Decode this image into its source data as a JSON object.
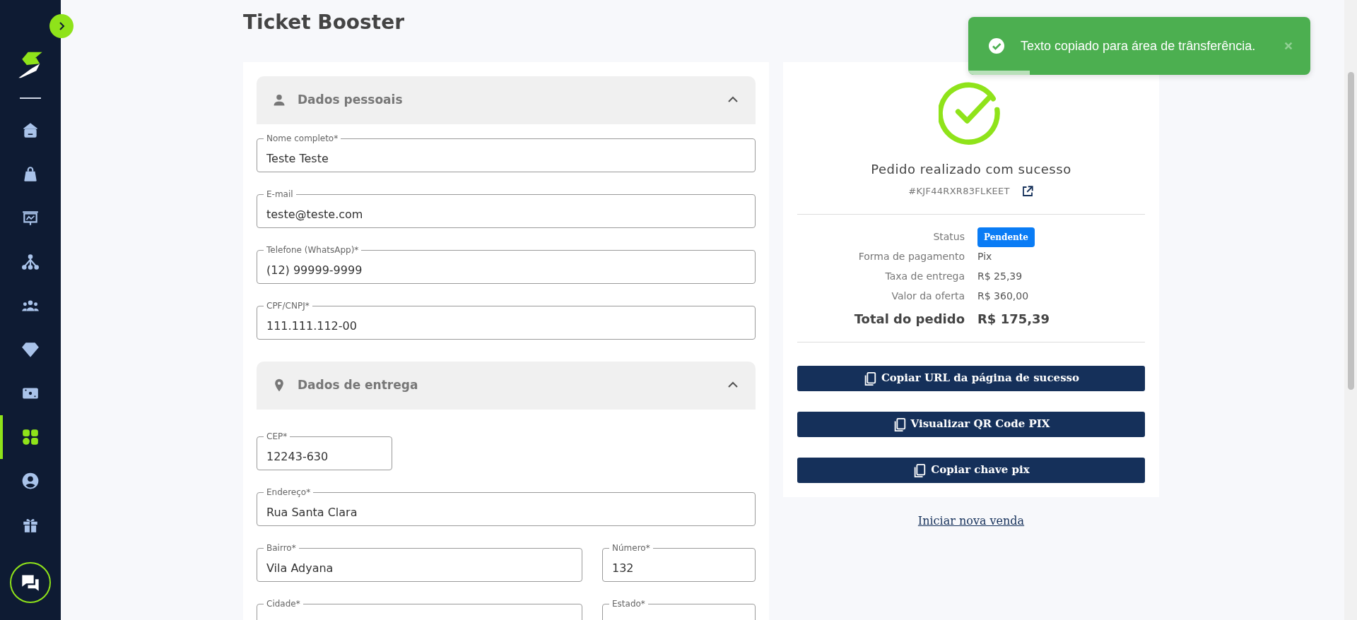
{
  "sidebar": {
    "items": [
      {
        "kind": "home",
        "selected": false
      },
      {
        "kind": "bag",
        "selected": false
      },
      {
        "kind": "presentation",
        "selected": false
      },
      {
        "kind": "network",
        "selected": false
      },
      {
        "kind": "people",
        "selected": false
      },
      {
        "kind": "diamond",
        "selected": false
      },
      {
        "kind": "ticket",
        "selected": false
      },
      {
        "kind": "grid",
        "selected": true
      },
      {
        "kind": "user",
        "selected": false
      },
      {
        "kind": "gift",
        "selected": false
      }
    ]
  },
  "page": {
    "title": "Ticket Booster"
  },
  "form": {
    "sections": [
      {
        "title": "Dados pessoais",
        "kind": "person",
        "expanded": true,
        "rows": [
          [
            {
              "label": "Nome completo*",
              "value": "Teste Teste"
            }
          ],
          [
            {
              "label": "E-mail",
              "value": "teste@teste.com"
            }
          ],
          [
            {
              "label": "Telefone (WhatsApp)*",
              "value": "(12) 99999-9999"
            }
          ],
          [
            {
              "label": "CPF/CNPJ*",
              "value": "111.111.112-00"
            }
          ]
        ]
      },
      {
        "title": "Dados de entrega",
        "kind": "pin",
        "expanded": true,
        "rows": [
          [
            {
              "label": "CEP*",
              "value": "12243-630",
              "kind": "short"
            }
          ],
          [
            {
              "label": "Endereço*",
              "value": "Rua Santa Clara"
            }
          ],
          [
            {
              "label": "Bairro*",
              "value": "Vila Adyana"
            },
            {
              "label": "Número*",
              "value": "132"
            }
          ],
          [
            {
              "label": "Cidade*"
            },
            {
              "label": "Estado*"
            }
          ]
        ]
      }
    ]
  },
  "order": {
    "title": "Pedido realizado com sucesso",
    "code": "#KJF44RXR83FLKEET",
    "details": [
      {
        "label": "Status",
        "value": "Pendente",
        "kind": "badge"
      },
      {
        "label": "Forma de pagamento",
        "value": "Pix",
        "kind": "text"
      },
      {
        "label": "Taxa de entrega",
        "value": "R$ 25,39",
        "kind": "text"
      },
      {
        "label": "Valor da oferta",
        "value": "R$ 360,00",
        "kind": "text"
      },
      {
        "label": "Total do pedido",
        "value": "R$ 175,39",
        "kind": "total"
      }
    ],
    "buttons": [
      {
        "label": "Copiar URL da página de sucesso"
      },
      {
        "label": "Visualizar QR Code PIX"
      },
      {
        "label": "Copiar chave pix"
      }
    ],
    "link": "Iniciar nova venda"
  },
  "toast": {
    "message": "Texto copiado para área de trânsferência.",
    "level": 0.18
  }
}
